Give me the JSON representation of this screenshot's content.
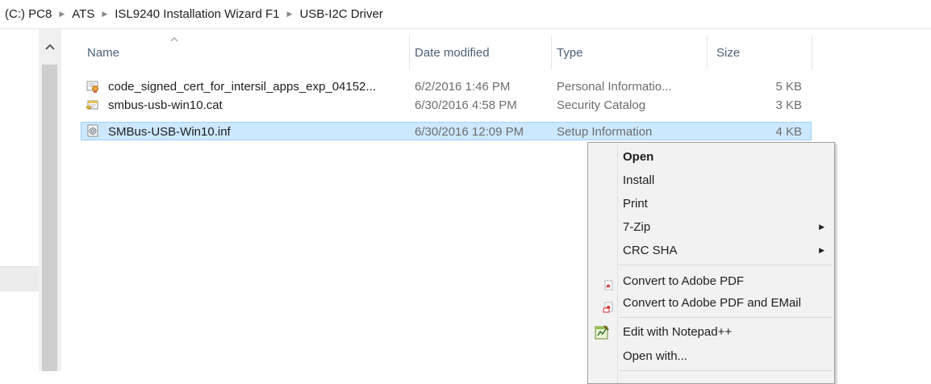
{
  "breadcrumb": [
    "(C:) PC8",
    "ATS",
    "ISL9240 Installation Wizard F1",
    "USB-I2C Driver"
  ],
  "columns": {
    "name": "Name",
    "date_modified": "Date modified",
    "type": "Type",
    "size": "Size"
  },
  "files": [
    {
      "name": "code_signed_cert_for_intersil_apps_exp_04152...",
      "date": "6/2/2016 1:46 PM",
      "type": "Personal Informatio...",
      "size": "5 KB",
      "icon": "certificate-file-icon"
    },
    {
      "name": "smbus-usb-win10.cat",
      "date": "6/30/2016 4:58 PM",
      "type": "Security Catalog",
      "size": "3 KB",
      "icon": "catalog-file-icon"
    },
    {
      "name": "SMBus-USB-Win10.inf",
      "date": "6/30/2016 12:09 PM",
      "type": "Setup Information",
      "size": "4 KB",
      "icon": "setup-info-file-icon"
    }
  ],
  "selected_file_index": 2,
  "context_menu": {
    "items": [
      {
        "label": "Open",
        "bold": true
      },
      {
        "label": "Install"
      },
      {
        "label": "Print"
      },
      {
        "label": "7-Zip",
        "submenu": true
      },
      {
        "label": "CRC SHA",
        "submenu": true
      },
      {
        "label": "Convert to Adobe PDF",
        "icon": "adobe-pdf-icon"
      },
      {
        "label": "Convert to Adobe PDF and EMail",
        "icon": "adobe-pdf-email-icon"
      },
      {
        "label": "Edit with Notepad++",
        "icon": "notepad-plus-plus-icon"
      },
      {
        "label": "Open with..."
      }
    ]
  },
  "colors": {
    "selection_bg": "#cce8ff",
    "selection_border": "#99d1ff",
    "header_text": "#4c607a",
    "menu_bg": "#f2f2f2"
  }
}
